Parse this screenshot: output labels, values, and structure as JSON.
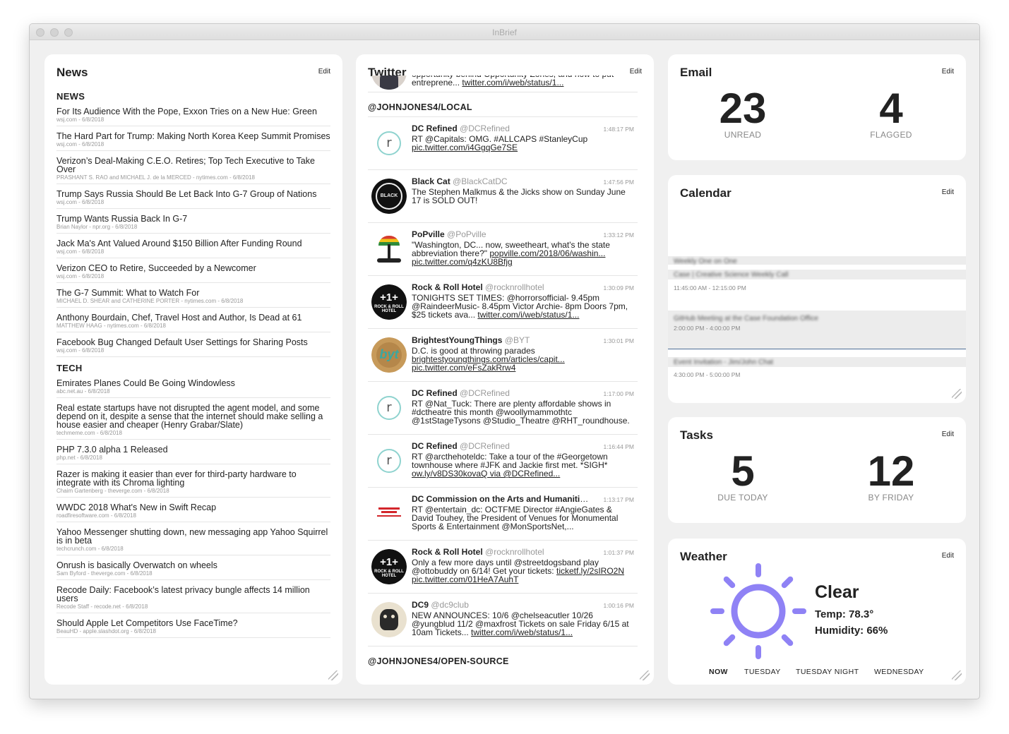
{
  "window": {
    "title": "InBrief"
  },
  "news": {
    "title": "News",
    "edit": "Edit",
    "sections": [
      {
        "name": "NEWS",
        "items": [
          {
            "title": "For Its Audience With the Pope, Exxon Tries on a New Hue: Green",
            "meta": "wsj.com - 6/8/2018"
          },
          {
            "title": "The Hard Part for Trump: Making North Korea Keep Summit Promises",
            "meta": "wsj.com - 6/8/2018"
          },
          {
            "title": "Verizon’s Deal-Making C.E.O. Retires; Top Tech Executive to Take Over",
            "meta": "PRASHANT S. RAO and MICHAEL J. de la MERCED - nytimes.com - 6/8/2018"
          },
          {
            "title": "Trump Says Russia Should Be Let Back Into G-7 Group of Nations",
            "meta": "wsj.com - 6/8/2018"
          },
          {
            "title": "Trump Wants Russia Back In G-7",
            "meta": "Brian Naylor - npr.org - 6/8/2018"
          },
          {
            "title": "Jack Ma's Ant Valued Around $150 Billion After Funding Round",
            "meta": "wsj.com - 6/8/2018"
          },
          {
            "title": "Verizon CEO to Retire, Succeeded by a Newcomer",
            "meta": "wsj.com - 6/8/2018"
          },
          {
            "title": "The G-7 Summit: What to Watch For",
            "meta": "MICHAEL D. SHEAR and CATHERINE PORTER - nytimes.com - 6/8/2018"
          },
          {
            "title": "Anthony Bourdain, Chef, Travel Host and Author, Is Dead at 61",
            "meta": "MATTHEW HAAG - nytimes.com - 6/8/2018"
          },
          {
            "title": "Facebook Bug Changed Default User Settings for Sharing Posts",
            "meta": "wsj.com - 6/8/2018"
          }
        ]
      },
      {
        "name": "TECH",
        "items": [
          {
            "title": "Emirates Planes Could Be Going Windowless",
            "meta": "abc.net.au - 6/8/2018"
          },
          {
            "title": "Real estate startups have not disrupted the agent model, and some depend on it, despite a sense that the internet should make selling a house easier and cheaper (Henry Grabar/Slate)",
            "meta": "techmeme.com - 6/8/2018"
          },
          {
            "title": "PHP 7.3.0 alpha 1 Released",
            "meta": "php.net - 6/8/2018"
          },
          {
            "title": "Razer is making it easier than ever for third-party hardware to integrate with its Chroma lighting",
            "meta": "Chaim Gartenberg - theverge.com - 6/8/2018"
          },
          {
            "title": "WWDC 2018 What's New in Swift Recap",
            "meta": "roadfiresoftware.com - 6/8/2018"
          },
          {
            "title": "Yahoo Messenger shutting down, new messaging app Yahoo Squirrel is in beta",
            "meta": "techcrunch.com - 6/8/2018"
          },
          {
            "title": "Onrush is basically Overwatch on wheels",
            "meta": "Sam Byford - theverge.com - 6/8/2018"
          },
          {
            "title": "Recode Daily: Facebook’s latest privacy bungle affects 14 million users",
            "meta": "Recode Staff - recode.net - 6/8/2018"
          },
          {
            "title": "Should Apple Let Competitors Use FaceTime?",
            "meta": "BeauHD - apple.slashdot.org - 6/8/2018"
          }
        ]
      }
    ]
  },
  "twitter": {
    "title": "Twitter",
    "edit": "Edit",
    "partial_top": {
      "text": "opportunity behind Opportunity Zones, and how to put entreprene...",
      "link": "twitter.com/i/web/status/1..."
    },
    "list_name": "@JOHNJONES4/LOCAL",
    "next_list_name": "@JOHNJONES4/OPEN-SOURCE",
    "tweets": [
      {
        "name": "DC Refined",
        "handle": "@DCRefined",
        "time": "1:48:17 PM",
        "text": "RT @Capitals: OMG. #ALLCAPS #StanleyCup",
        "link": "pic.twitter.com/i4GgqGe7SE",
        "avatar": "dcrefined"
      },
      {
        "name": "Black Cat",
        "handle": "@BlackCatDC",
        "time": "1:47:56 PM",
        "text": "The Stephen Malkmus & the Jicks show on Sunday June 17 is SOLD OUT!",
        "link": "",
        "avatar": "blackcat"
      },
      {
        "name": "PoPville",
        "handle": "@PoPville",
        "time": "1:33:12 PM",
        "text": "\"Washington, DC... now, sweetheart, what's the state abbreviation there?\"",
        "link": "popville.com/2018/06/washin... pic.twitter.com/q4zKU8Bfjg",
        "avatar": "popville"
      },
      {
        "name": "Rock & Roll Hotel",
        "handle": "@rocknrollhotel",
        "time": "1:30:09 PM",
        "text": "TONIGHTS SET TIMES: @horrorsofficial- 9.45pm @RaindeerMusic- 8.45pm Victor Archie- 8pm Doors 7pm, $25 tickets ava...",
        "link": "twitter.com/i/web/status/1...",
        "avatar": "rnr"
      },
      {
        "name": "BrightestYoungThings",
        "handle": "@BYT",
        "time": "1:30:01 PM",
        "text": "D.C. is good at throwing parades",
        "link": "brightestyoungthings.com/articles/capit... pic.twitter.com/eFsZakRrw4",
        "avatar": "byt"
      },
      {
        "name": "DC Refined",
        "handle": "@DCRefined",
        "time": "1:17:00 PM",
        "text": "RT @Nat_Tuck: There are plenty affordable shows in #dctheatre this month @woollymammothtc @1stStageTysons @Studio_Theatre @RHT_roundhouse.",
        "link": "",
        "avatar": "dcrefined"
      },
      {
        "name": "DC Refined",
        "handle": "@DCRefined",
        "time": "1:16:44 PM",
        "text": "RT @arcthehoteldc: Take a tour of the #Georgetown townhouse where #JFK and Jackie first met. *SIGH*",
        "link": "ow.ly/v8DS30kovaQ via @DCRefined...",
        "avatar": "dcrefined"
      },
      {
        "name": "DC Commission on the Arts and Humanities (CAH)",
        "handle": "@...",
        "time": "1:13:17 PM",
        "text": "RT @entertain_dc: OCTFME Director #AngieGates & David Touhey, the President of Venues for Monumental Sports & Entertainment @MonSportsNet,...",
        "link": "",
        "avatar": "dccah"
      },
      {
        "name": "Rock & Roll Hotel",
        "handle": "@rocknrollhotel",
        "time": "1:01:37 PM",
        "text": "Only a few more days until @streetdogsband play @ottobuddy on 6/14! Get your tickets:",
        "link": "ticketf.ly/2sIRO2N pic.twitter.com/01HeA7AuhT",
        "avatar": "rnr"
      },
      {
        "name": "DC9",
        "handle": "@dc9club",
        "time": "1:00:16 PM",
        "text": "NEW ANNOUNCES: 10/6 @chelseacutler 10/26 @yungblud 11/2 @maxfrost Tickets on sale Friday 6/15 at 10am Tickets...",
        "link": "twitter.com/i/web/status/1...",
        "avatar": "dc9"
      }
    ]
  },
  "email": {
    "title": "Email",
    "edit": "Edit",
    "unread": "23",
    "unread_label": "UNREAD",
    "flagged": "4",
    "flagged_label": "FLAGGED"
  },
  "calendar": {
    "title": "Calendar",
    "edit": "Edit",
    "events": [
      {
        "title": "Weekly One on One",
        "time": ""
      },
      {
        "title": "Case | Creative Science Weekly Call",
        "time": "11:45:00 AM - 12:15:00 PM"
      },
      {
        "title": "GitHub Meeting at the Case Foundation Office",
        "time": "2:00:00 PM - 4:00:00 PM"
      },
      {
        "title": "Event Invitation - Jim/John Chat",
        "time": "4:30:00 PM - 5:00:00 PM"
      }
    ]
  },
  "tasks": {
    "title": "Tasks",
    "edit": "Edit",
    "due_today": "5",
    "due_today_label": "DUE TODAY",
    "by_friday": "12",
    "by_friday_label": "BY FRIDAY"
  },
  "weather": {
    "title": "Weather",
    "edit": "Edit",
    "condition": "Clear",
    "temp": "Temp: 78.3°",
    "humidity": "Humidity: 66%",
    "icon": "sun-icon",
    "icon_color": "#8f82f5",
    "tabs": [
      "NOW",
      "TUESDAY",
      "TUESDAY NIGHT",
      "WEDNESDAY"
    ]
  }
}
